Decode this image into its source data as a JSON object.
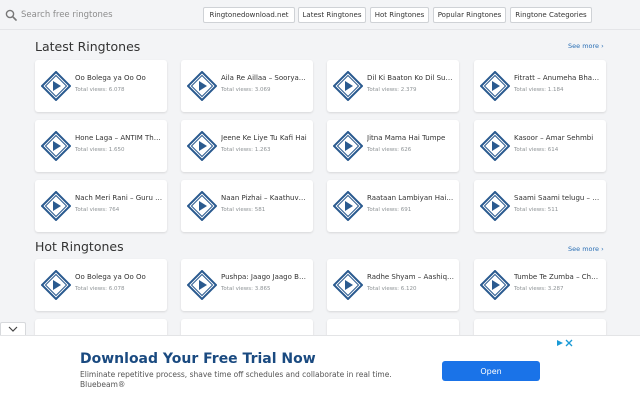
{
  "search": {
    "placeholder": "Search free ringtones"
  },
  "nav": [
    {
      "label": "Ringtonedownload.net"
    },
    {
      "label": "Latest Ringtones"
    },
    {
      "label": "Hot Ringtones"
    },
    {
      "label": "Popular Ringtones"
    },
    {
      "label": "Ringtone Categories"
    }
  ],
  "sections": [
    {
      "title": "Latest Ringtones",
      "see_more": "See more ›",
      "cards": [
        {
          "title": "Oo Bolega ya Oo Oo",
          "views": "Total views: 6.078"
        },
        {
          "title": "Aila Re Aillaa – Sooryavanshi",
          "views": "Total views: 3.069"
        },
        {
          "title": "Dil Ki Baaton Ko Dil Suna Do",
          "views": "Total views: 2.379"
        },
        {
          "title": "Fitratt – Anumeha Bhasker",
          "views": "Total views: 1.184"
        },
        {
          "title": "Hone Laga – ANTIM The Final Truth",
          "views": "Total views: 1.650"
        },
        {
          "title": "Jeene Ke Liye Tu Kafi Hai",
          "views": "Total views: 1.263"
        },
        {
          "title": "Jitna Mama Hai Tumpe",
          "views": "Total views: 626"
        },
        {
          "title": "Kasoor – Amar Sehmbi",
          "views": "Total views: 614"
        },
        {
          "title": "Nach Meri Rani – Guru Randhawa",
          "views": "Total views: 764"
        },
        {
          "title": "Naan Pizhai – Kaathuvaakula",
          "views": "Total views: 581"
        },
        {
          "title": "Raataan Lambiyan Hai Shershaah",
          "views": "Total views: 691"
        },
        {
          "title": "Saami Saami telugu – Pushpa",
          "views": "Total views: 511"
        }
      ]
    },
    {
      "title": "Hot Ringtones",
      "see_more": "See more ›",
      "cards": [
        {
          "title": "Oo Bolega ya Oo Oo",
          "views": "Total views: 6.078"
        },
        {
          "title": "Pushpa: Jaago Jaago Bakre",
          "views": "Total views: 3.865"
        },
        {
          "title": "Radhe Shyam – Aashiqui Aa Gayi",
          "views": "Total views: 6.120"
        },
        {
          "title": "Tumbe Te Zumba – Chhello Divas",
          "views": "Total views: 3.287"
        }
      ]
    }
  ],
  "ad": {
    "headline": "Download Your Free Trial Now",
    "text": "Eliminate repetitive process, shave time off schedules and collaborate in real time. Bluebeam®",
    "button": "Open"
  },
  "colors": {
    "accent": "#2a5a8f",
    "link": "#2a6fb5",
    "ad_button": "#1a73e8"
  },
  "icons": {
    "play": "play-diamond-icon",
    "search": "search-icon",
    "collapse": "chevron-down-icon",
    "ad_info": "info-icon",
    "ad_close": "close-icon"
  }
}
